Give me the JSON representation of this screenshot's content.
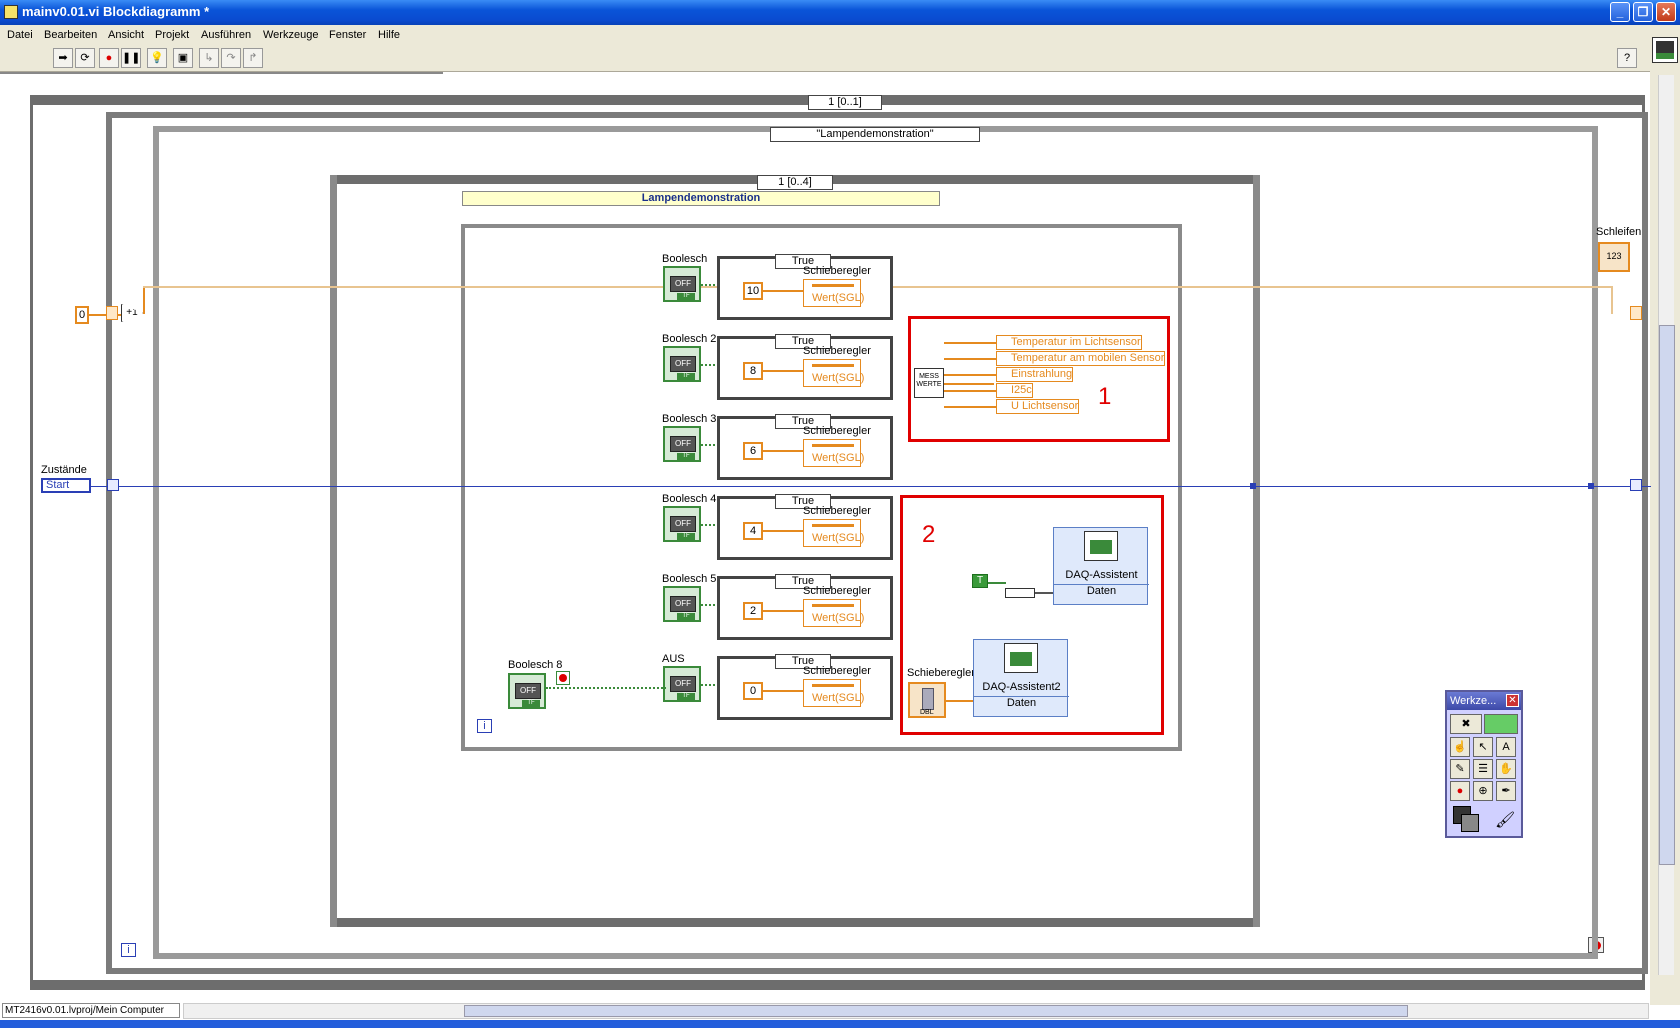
{
  "window": {
    "title": "mainv0.01.vi Blockdiagramm *"
  },
  "menu": [
    "Datei",
    "Bearbeiten",
    "Ansicht",
    "Projekt",
    "Ausführen",
    "Werkzeuge",
    "Fenster",
    "Hilfe"
  ],
  "diagram": {
    "outer_sequence_selector": "1 [0..1]",
    "case_selector": "\"Lampendemonstration\"",
    "inner_sequence_selector": "1 [0..4]",
    "frame_label": "Lampendemonstration",
    "iteration_constant": "0",
    "increment_label": "+1",
    "states_label": "Zustände",
    "states_value": "Start",
    "loop_label": "Schleifen",
    "loop_indicator": "123",
    "booleans": [
      {
        "label": "Boolesch",
        "value": "10",
        "case": "True"
      },
      {
        "label": "Boolesch 2",
        "value": "8",
        "case": "True"
      },
      {
        "label": "Boolesch 3",
        "value": "6",
        "case": "True"
      },
      {
        "label": "Boolesch 4",
        "value": "4",
        "case": "True"
      },
      {
        "label": "Boolesch 5",
        "value": "2",
        "case": "True"
      },
      {
        "label": "AUS",
        "value": "0",
        "case": "True"
      }
    ],
    "bool_off_text": "OFF",
    "bool_tf_text": "TF",
    "slider_node_label": "Schieberegler",
    "slider_node_value": "Wert(SGL)",
    "boolean8_label": "Boolesch 8",
    "box1": {
      "number": "1",
      "cluster_label": "MESS WERTE",
      "fields": [
        "Temperatur im Lichtsensor",
        "Temperatur am mobilen Sensor",
        "Einstrahlung",
        "I25c",
        "U Lichtsensor"
      ]
    },
    "box2": {
      "number": "2",
      "true_const": "T",
      "daq1_title": "DAQ-Assistent",
      "daq1_sub": "Daten",
      "slider_label": "Schieberegler",
      "slider_type": "DBL",
      "daq2_title": "DAQ-Assistent2",
      "daq2_sub": "Daten"
    },
    "info_icon": "i"
  },
  "palette": {
    "title": "Werkze..."
  },
  "status": {
    "path": "MT2416v0.01.lvproj/Mein Computer"
  }
}
